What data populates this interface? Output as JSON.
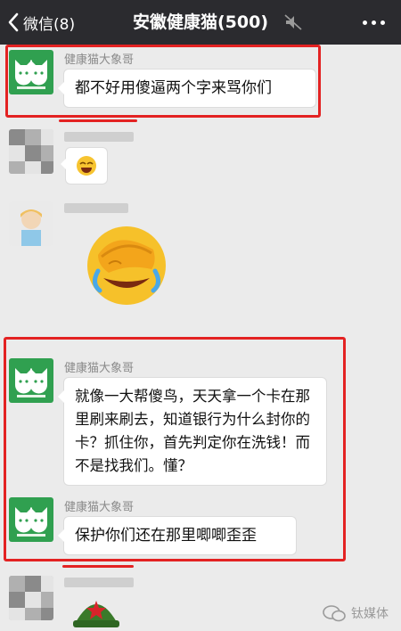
{
  "nav": {
    "back_label": "微信(8)",
    "title": "安徽健康猫(500)",
    "icons": [
      "chevron-left-icon",
      "mute-icon",
      "more-icon"
    ]
  },
  "messages": [
    {
      "sender": "健康猫大象哥",
      "text": "都不好用傻逼两个字来骂你们"
    },
    {
      "sender": "",
      "sticker": "laughing-face-emoji"
    },
    {
      "sender": "",
      "sticker": "facepalm-laugh-sticker"
    },
    {
      "sender": "健康猫大象哥",
      "text": "就像一大帮傻鸟，天天拿一个卡在那里刷来刷去，知道银行为什么封你的卡？抓住你，首先判定你在洗钱！而不是找我们。懂？"
    },
    {
      "sender": "健康猫大象哥",
      "text": "保护你们还在那里唧唧歪歪"
    }
  ],
  "watermark": {
    "text": "钛媒体"
  },
  "colors": {
    "nav_bg": "#2b2b2f",
    "chat_bg": "#ebebeb",
    "highlight": "#e32222",
    "cat_avatar": "#30a050"
  }
}
